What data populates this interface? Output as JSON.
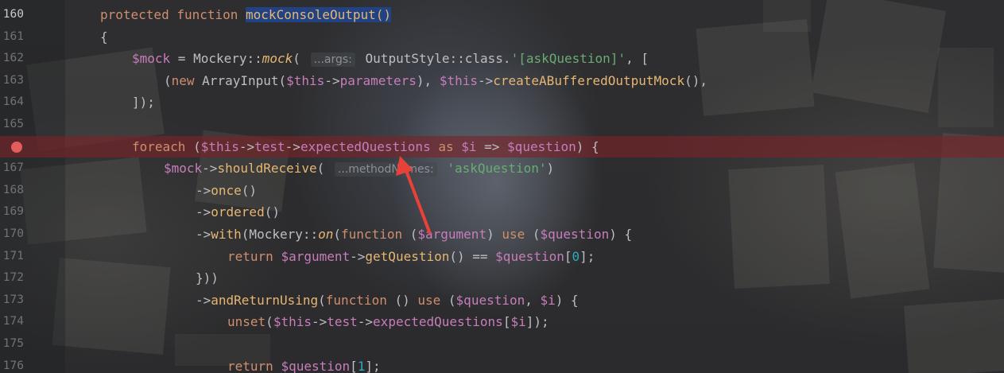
{
  "editor": {
    "lines": [
      {
        "num": "160",
        "current": true,
        "indent": 1,
        "tokens": [
          [
            "kw",
            "protected "
          ],
          [
            "kw",
            "function "
          ],
          [
            "hl",
            "mockConsoleOutput()"
          ]
        ]
      },
      {
        "num": "161",
        "indent": 1,
        "tokens": [
          [
            "plain",
            "{"
          ]
        ]
      },
      {
        "num": "162",
        "indent": 2,
        "tokens": [
          [
            "var",
            "$mock"
          ],
          [
            "plain",
            " = Mockery::"
          ],
          [
            "it",
            "mock"
          ],
          [
            "plain",
            "( "
          ],
          [
            "hint",
            "...args:"
          ],
          [
            "plain",
            " OutputStyle::class."
          ],
          [
            "str",
            "'[askQuestion]'"
          ],
          [
            "plain",
            ", ["
          ]
        ]
      },
      {
        "num": "163",
        "indent": 3,
        "tokens": [
          [
            "plain",
            "("
          ],
          [
            "kw",
            "new "
          ],
          [
            "plain",
            "ArrayInput("
          ],
          [
            "var",
            "$this"
          ],
          [
            "plain",
            "->"
          ],
          [
            "var",
            "parameters"
          ],
          [
            "plain",
            "), "
          ],
          [
            "var",
            "$this"
          ],
          [
            "plain",
            "->"
          ],
          [
            "fncall",
            "createABufferedOutputMock"
          ],
          [
            "plain",
            "(),"
          ]
        ]
      },
      {
        "num": "164",
        "indent": 2,
        "tokens": [
          [
            "plain",
            "]);"
          ]
        ]
      },
      {
        "num": "165",
        "indent": 0,
        "tokens": []
      },
      {
        "num": "166",
        "breakpoint": true,
        "indent": 2,
        "tokens": [
          [
            "kw",
            "foreach "
          ],
          [
            "plain",
            "("
          ],
          [
            "var",
            "$this"
          ],
          [
            "plain",
            "->"
          ],
          [
            "var",
            "test"
          ],
          [
            "plain",
            "->"
          ],
          [
            "var",
            "expectedQuestions"
          ],
          [
            "plain",
            " "
          ],
          [
            "kw",
            "as "
          ],
          [
            "var",
            "$i"
          ],
          [
            "plain",
            " => "
          ],
          [
            "var",
            "$question"
          ],
          [
            "plain",
            ") {"
          ]
        ]
      },
      {
        "num": "167",
        "indent": 3,
        "tokens": [
          [
            "var",
            "$mock"
          ],
          [
            "plain",
            "->"
          ],
          [
            "fncall",
            "shouldReceive"
          ],
          [
            "plain",
            "( "
          ],
          [
            "hint",
            "...methodNames:"
          ],
          [
            "plain",
            " "
          ],
          [
            "str",
            "'askQuestion'"
          ],
          [
            "plain",
            ")"
          ]
        ]
      },
      {
        "num": "168",
        "indent": 4,
        "tokens": [
          [
            "plain",
            "->"
          ],
          [
            "fncall",
            "once"
          ],
          [
            "plain",
            "()"
          ]
        ]
      },
      {
        "num": "169",
        "indent": 4,
        "tokens": [
          [
            "plain",
            "->"
          ],
          [
            "fncall",
            "ordered"
          ],
          [
            "plain",
            "()"
          ]
        ]
      },
      {
        "num": "170",
        "indent": 4,
        "tokens": [
          [
            "plain",
            "->"
          ],
          [
            "fncall",
            "with"
          ],
          [
            "plain",
            "(Mockery::"
          ],
          [
            "it",
            "on"
          ],
          [
            "plain",
            "("
          ],
          [
            "kw",
            "function "
          ],
          [
            "plain",
            "("
          ],
          [
            "var",
            "$argument"
          ],
          [
            "plain",
            ") "
          ],
          [
            "kw",
            "use "
          ],
          [
            "plain",
            "("
          ],
          [
            "var",
            "$question"
          ],
          [
            "plain",
            ") {"
          ]
        ]
      },
      {
        "num": "171",
        "indent": 5,
        "tokens": [
          [
            "kw",
            "return "
          ],
          [
            "var",
            "$argument"
          ],
          [
            "plain",
            "->"
          ],
          [
            "fncall",
            "getQuestion"
          ],
          [
            "plain",
            "() == "
          ],
          [
            "var",
            "$question"
          ],
          [
            "plain",
            "["
          ],
          [
            "num",
            "0"
          ],
          [
            "plain",
            "];"
          ]
        ]
      },
      {
        "num": "172",
        "indent": 4,
        "tokens": [
          [
            "plain",
            "}))"
          ]
        ]
      },
      {
        "num": "173",
        "indent": 4,
        "tokens": [
          [
            "plain",
            "->"
          ],
          [
            "fncall",
            "andReturnUsing"
          ],
          [
            "plain",
            "("
          ],
          [
            "kw",
            "function "
          ],
          [
            "plain",
            "() "
          ],
          [
            "kw",
            "use "
          ],
          [
            "plain",
            "("
          ],
          [
            "var",
            "$question"
          ],
          [
            "plain",
            ", "
          ],
          [
            "var",
            "$i"
          ],
          [
            "plain",
            ") {"
          ]
        ]
      },
      {
        "num": "174",
        "indent": 5,
        "tokens": [
          [
            "kw",
            "unset"
          ],
          [
            "plain",
            "("
          ],
          [
            "var",
            "$this"
          ],
          [
            "plain",
            "->"
          ],
          [
            "var",
            "test"
          ],
          [
            "plain",
            "->"
          ],
          [
            "var",
            "expectedQuestions"
          ],
          [
            "plain",
            "["
          ],
          [
            "var",
            "$i"
          ],
          [
            "plain",
            "]);"
          ]
        ]
      },
      {
        "num": "175",
        "indent": 0,
        "tokens": []
      },
      {
        "num": "176",
        "indent": 5,
        "tokens": [
          [
            "kw",
            "return "
          ],
          [
            "var",
            "$question"
          ],
          [
            "plain",
            "["
          ],
          [
            "num",
            "1"
          ],
          [
            "plain",
            "];"
          ]
        ]
      }
    ]
  },
  "annotation": {
    "color": "#e8413a",
    "icon": "red-arrow-icon"
  }
}
